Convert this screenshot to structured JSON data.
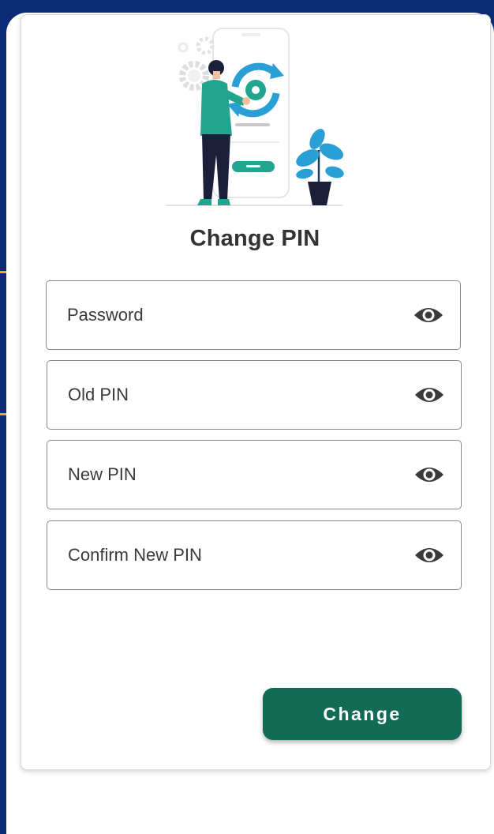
{
  "form": {
    "title": "Change PIN",
    "fields": [
      {
        "placeholder": "Password",
        "value": "",
        "icon": "eye-icon"
      },
      {
        "placeholder": "Old PIN",
        "value": "",
        "icon": "eye-icon"
      },
      {
        "placeholder": "New PIN",
        "value": "",
        "icon": "eye-icon"
      },
      {
        "placeholder": "Confirm New PIN",
        "value": "",
        "icon": "eye-icon"
      }
    ],
    "submit_label": "Change"
  },
  "colors": {
    "background": "#0b2a78",
    "accent": "#f0a818",
    "primary": "#116b55",
    "illustration_blue": "#2a9fd6",
    "illustration_teal": "#22a58e"
  }
}
